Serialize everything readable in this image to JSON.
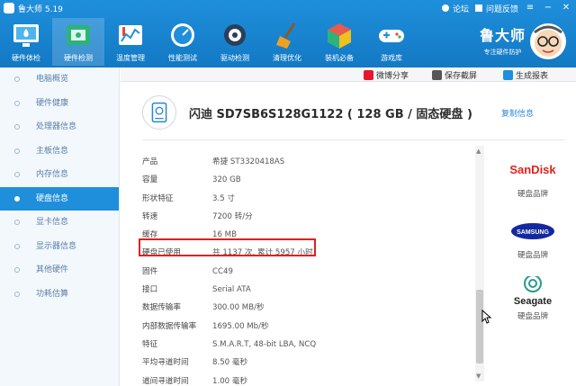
{
  "window": {
    "title": "鲁大师 5.19",
    "links": [
      "论坛",
      "问题反馈"
    ],
    "controls": [
      "≡",
      "−",
      "✕"
    ]
  },
  "nav": [
    {
      "label": "硬件体检",
      "icon": "monitor-icon"
    },
    {
      "label": "硬件检测",
      "icon": "circuit-board-icon"
    },
    {
      "label": "温度管理",
      "icon": "thermometer-chart-icon"
    },
    {
      "label": "性能测试",
      "icon": "speedometer-icon"
    },
    {
      "label": "驱动检测",
      "icon": "gear-driver-icon"
    },
    {
      "label": "清理优化",
      "icon": "broom-icon"
    },
    {
      "label": "装机必备",
      "icon": "cube-icon"
    },
    {
      "label": "游戏库",
      "icon": "gamepad-icon"
    }
  ],
  "brand": {
    "name": "鲁大师",
    "slogan": "专注硬件防护"
  },
  "sidebar": [
    {
      "label": "电脑概览"
    },
    {
      "label": "硬件健康"
    },
    {
      "label": "处理器信息"
    },
    {
      "label": "主板信息"
    },
    {
      "label": "内存信息"
    },
    {
      "label": "硬盘信息"
    },
    {
      "label": "显卡信息"
    },
    {
      "label": "显示器信息"
    },
    {
      "label": "其他硬件"
    },
    {
      "label": "功耗估算"
    }
  ],
  "actions": {
    "share": "微博分享",
    "screenshot": "保存截屏",
    "report": "生成报表"
  },
  "disk": {
    "title": "闪迪 SD7SB6S128G1122 ( 128 GB / 固态硬盘 )",
    "copy_label": "复制信息"
  },
  "specs": [
    {
      "key": "产品",
      "value": "希捷 ST3320418AS"
    },
    {
      "key": "容量",
      "value": "320 GB"
    },
    {
      "key": "形状特征",
      "value": "3.5 寸"
    },
    {
      "key": "转速",
      "value": "7200 转/分"
    },
    {
      "key": "缓存",
      "value": "16 MB"
    },
    {
      "key": "硬盘已使用",
      "value": "共 1137 次, 累计 5957 小时"
    },
    {
      "key": "固件",
      "value": "CC49"
    },
    {
      "key": "接口",
      "value": "Serial ATA"
    },
    {
      "key": "数据传输率",
      "value": "300.00 MB/秒"
    },
    {
      "key": "内部数据传输率",
      "value": "1695.00 Mb/秒"
    },
    {
      "key": "特征",
      "value": "S.M.A.R.T, 48-bit LBA, NCQ"
    },
    {
      "key": "平均寻道时间",
      "value": "8.50 毫秒"
    },
    {
      "key": "道间寻道时间",
      "value": "1.00 毫秒"
    }
  ],
  "brand_panel": [
    {
      "logo_text": "SanDisk",
      "caption": "硬盘品牌",
      "color": "#e2231a"
    },
    {
      "logo_text": "SAMSUNG",
      "caption": "硬盘品牌",
      "color": "#1428a0"
    },
    {
      "logo_text": "Seagate",
      "caption": "硬盘品牌",
      "color": "#2a9a8a"
    }
  ],
  "colors": {
    "accent": "#1f8fdc",
    "highlight_border": "#e02020",
    "link": "#2a86d6"
  }
}
